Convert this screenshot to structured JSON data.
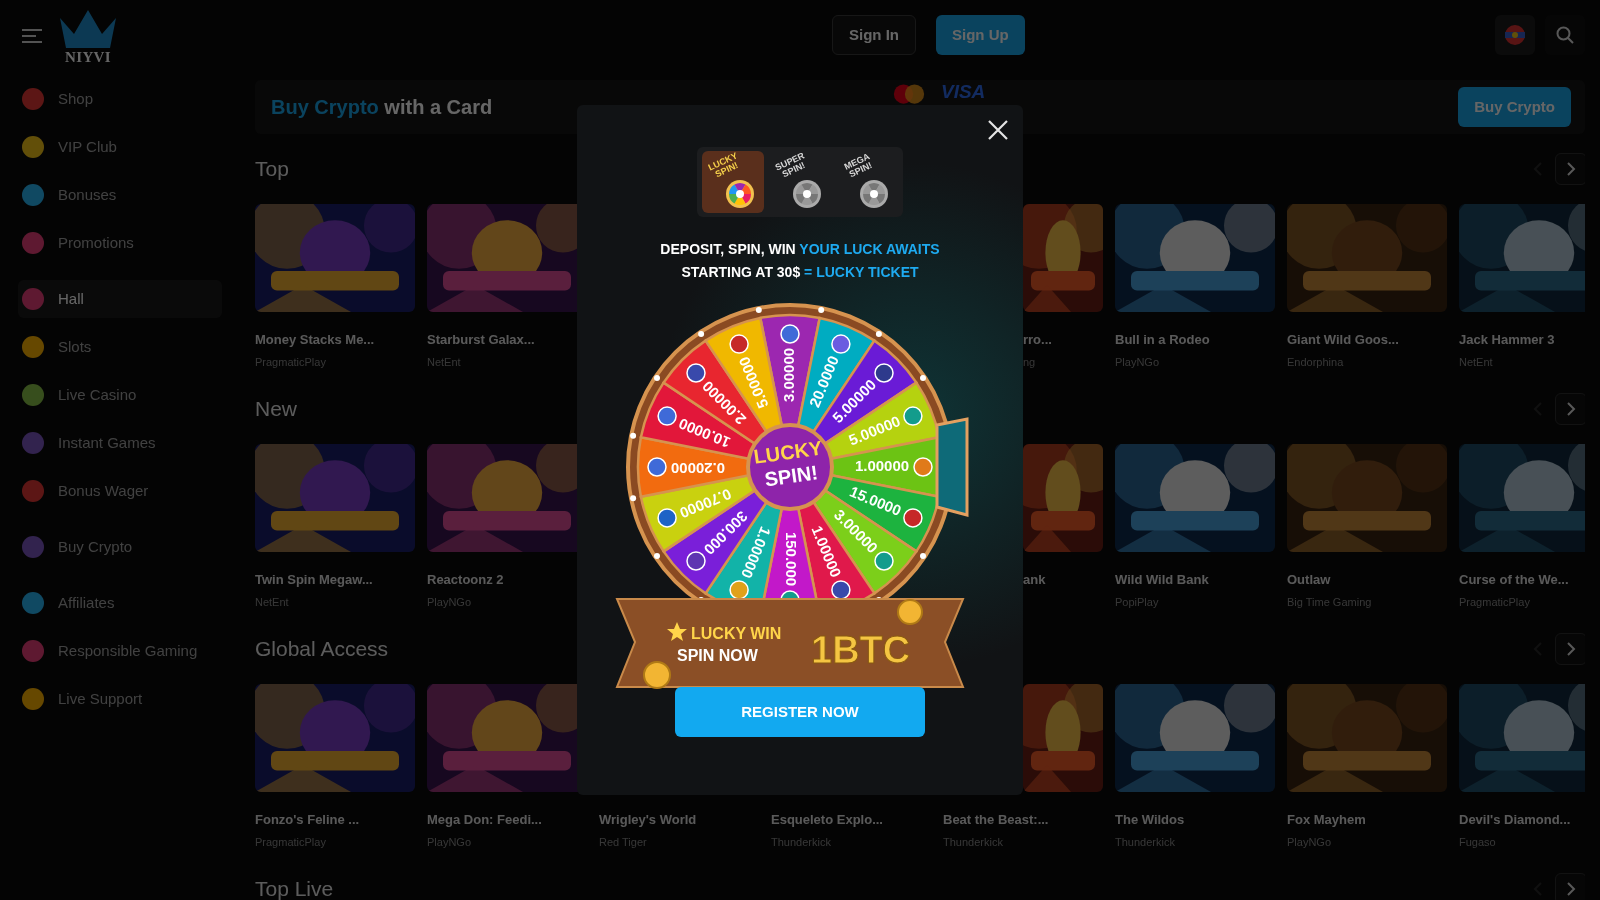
{
  "header": {
    "logo": "NIYVI",
    "sign_in": "Sign In",
    "sign_up": "Sign Up"
  },
  "sidebar": {
    "groups": [
      {
        "items": [
          {
            "label": "Shop",
            "selected": false
          },
          {
            "label": "VIP Club",
            "selected": false
          },
          {
            "label": "Bonuses",
            "selected": false
          },
          {
            "label": "Promotions",
            "selected": false
          }
        ]
      },
      {
        "items": [
          {
            "label": "Hall",
            "selected": true
          },
          {
            "label": "Slots",
            "selected": false
          },
          {
            "label": "Live Casino",
            "selected": false
          },
          {
            "label": "Instant Games",
            "selected": false
          },
          {
            "label": "Bonus Wager",
            "selected": false
          }
        ]
      },
      {
        "items": [
          {
            "label": "Buy Crypto",
            "selected": false
          }
        ]
      },
      {
        "items": [
          {
            "label": "Affiliates",
            "selected": false
          },
          {
            "label": "Responsible Gaming",
            "selected": false
          },
          {
            "label": "Live Support",
            "selected": false
          }
        ]
      }
    ]
  },
  "banner": {
    "highlight": "Buy Crypto",
    "text": "with a Card",
    "card_logo": "VISA",
    "button": "Buy Crypto"
  },
  "sections": [
    {
      "title": "Top",
      "games": [
        {
          "kind": "card",
          "title": "Money Stacks Me...",
          "provider": "PragmaticPlay"
        },
        {
          "kind": "card",
          "title": "Starburst Galax...",
          "provider": "NetEnt"
        },
        {
          "kind": "covered"
        },
        {
          "kind": "covered"
        },
        {
          "kind": "partial",
          "title": "rro...",
          "provider": "ng"
        },
        {
          "kind": "card",
          "title": "Bull in a Rodeo",
          "provider": "PlayNGo"
        },
        {
          "kind": "card",
          "title": "Giant Wild Goos...",
          "provider": "Endorphina"
        },
        {
          "kind": "card",
          "title": "Jack Hammer 3",
          "provider": "NetEnt"
        }
      ]
    },
    {
      "title": "New",
      "games": [
        {
          "kind": "card",
          "title": "Twin Spin Megaw...",
          "provider": "NetEnt"
        },
        {
          "kind": "card",
          "title": "Reactoonz 2",
          "provider": "PlayNGo"
        },
        {
          "kind": "covered"
        },
        {
          "kind": "covered"
        },
        {
          "kind": "partial",
          "title": "ank"
        },
        {
          "kind": "card",
          "title": "Wild Wild Bank",
          "provider": "PopiPlay"
        },
        {
          "kind": "card",
          "title": "Outlaw",
          "provider": "Big Time Gaming"
        },
        {
          "kind": "card",
          "title": "Curse of the We...",
          "provider": "PragmaticPlay"
        }
      ]
    },
    {
      "title": "Global Access",
      "games": [
        {
          "kind": "card",
          "title": "Fonzo's Feline ...",
          "provider": "PragmaticPlay"
        },
        {
          "kind": "card",
          "title": "Mega Don: Feedi...",
          "provider": "PlayNGo"
        },
        {
          "kind": "textonly",
          "title": "Wrigley's World",
          "provider": "Red Tiger"
        },
        {
          "kind": "textonly",
          "title": "Esqueleto Explo...",
          "provider": "Thunderkick"
        },
        {
          "kind": "partialimage",
          "title": "Beat the Beast:...",
          "provider": "Thunderkick"
        },
        {
          "kind": "card",
          "title": "The Wildos",
          "provider": "Thunderkick"
        },
        {
          "kind": "card",
          "title": "Fox Mayhem",
          "provider": "PlayNGo"
        },
        {
          "kind": "card",
          "title": "Devil's Diamond...",
          "provider": "Fugaso"
        }
      ]
    },
    {
      "title": "Top Live"
    }
  ],
  "modal": {
    "tabs": [
      {
        "label": "LUCKY SPIN!",
        "selected": true
      },
      {
        "label": "SUPER SPIN!",
        "selected": false
      },
      {
        "label": "MEGA SPIN!",
        "selected": false
      }
    ],
    "headline": [
      {
        "text": "DEPOSIT, SPIN, WIN",
        "accent": "YOUR LUCK AWAITS"
      },
      {
        "text": "STARTING AT 30$",
        "accent": "= LUCKY TICKET"
      }
    ],
    "wheel": {
      "hub": [
        "LUCKY",
        "SPIN!"
      ],
      "segments": [
        {
          "value": "3.00000",
          "color": "#9c27b0"
        },
        {
          "value": "20.0000",
          "color": "#00acc1"
        },
        {
          "value": "5.00000",
          "color": "#6a1bd6"
        },
        {
          "value": "5.00000",
          "color": "#b5d20f"
        },
        {
          "value": "1.00000",
          "color": "#6cc314"
        },
        {
          "value": "15.0000",
          "color": "#1db33f"
        },
        {
          "value": "3.00000",
          "color": "#7ccf1a"
        },
        {
          "value": "1.00000",
          "color": "#e0194b"
        },
        {
          "value": "150.000",
          "color": "#c218c9"
        },
        {
          "value": "1.00000",
          "color": "#12b3a8"
        },
        {
          "value": "300.000",
          "color": "#7a1fd9"
        },
        {
          "value": "0.70000",
          "color": "#c9d10f"
        },
        {
          "value": "0.20000",
          "color": "#f26b0f"
        },
        {
          "value": "10.0000",
          "color": "#e2173a"
        },
        {
          "value": "2.00000",
          "color": "#e8262f"
        },
        {
          "value": "5.00000",
          "color": "#f0b800"
        }
      ]
    },
    "ribbon": {
      "line1": "LUCKY WIN",
      "line2": "SPIN NOW",
      "prize": "1BTC"
    },
    "button": "REGISTER NOW"
  }
}
